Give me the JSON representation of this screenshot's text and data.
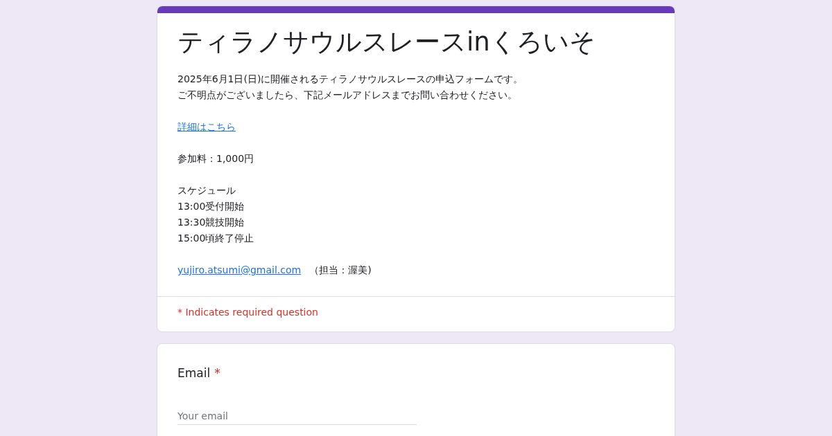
{
  "form": {
    "title": "ティラノサウルスレースinくろいそ",
    "description": [
      [
        {
          "kind": "text",
          "text": "2025年6月1日(日)に開催されるティラノサウルスレースの申込フォームです。"
        },
        {
          "kind": "text",
          "text": "ご不明点がございましたら、下記メールアドレスまでお問い合わせください。"
        }
      ],
      [
        {
          "kind": "link",
          "text": "詳細はこちら"
        }
      ],
      [
        {
          "kind": "text",
          "text": "参加料：1,000円"
        }
      ],
      [
        {
          "kind": "text",
          "text": "スケジュール"
        },
        {
          "kind": "text",
          "text": "13:00受付開始"
        },
        {
          "kind": "text",
          "text": "13:30競技開始"
        },
        {
          "kind": "text",
          "text": "15:00頃終了停止"
        }
      ],
      [
        {
          "kind": "link_note",
          "text": "yujiro.atsumi@gmail.com",
          "note": "（担当：渥美)"
        }
      ]
    ],
    "required_note": "* Indicates required question"
  },
  "questions": [
    {
      "label": "Email",
      "required": true,
      "required_mark": "*",
      "placeholder": "Your email"
    }
  ]
}
